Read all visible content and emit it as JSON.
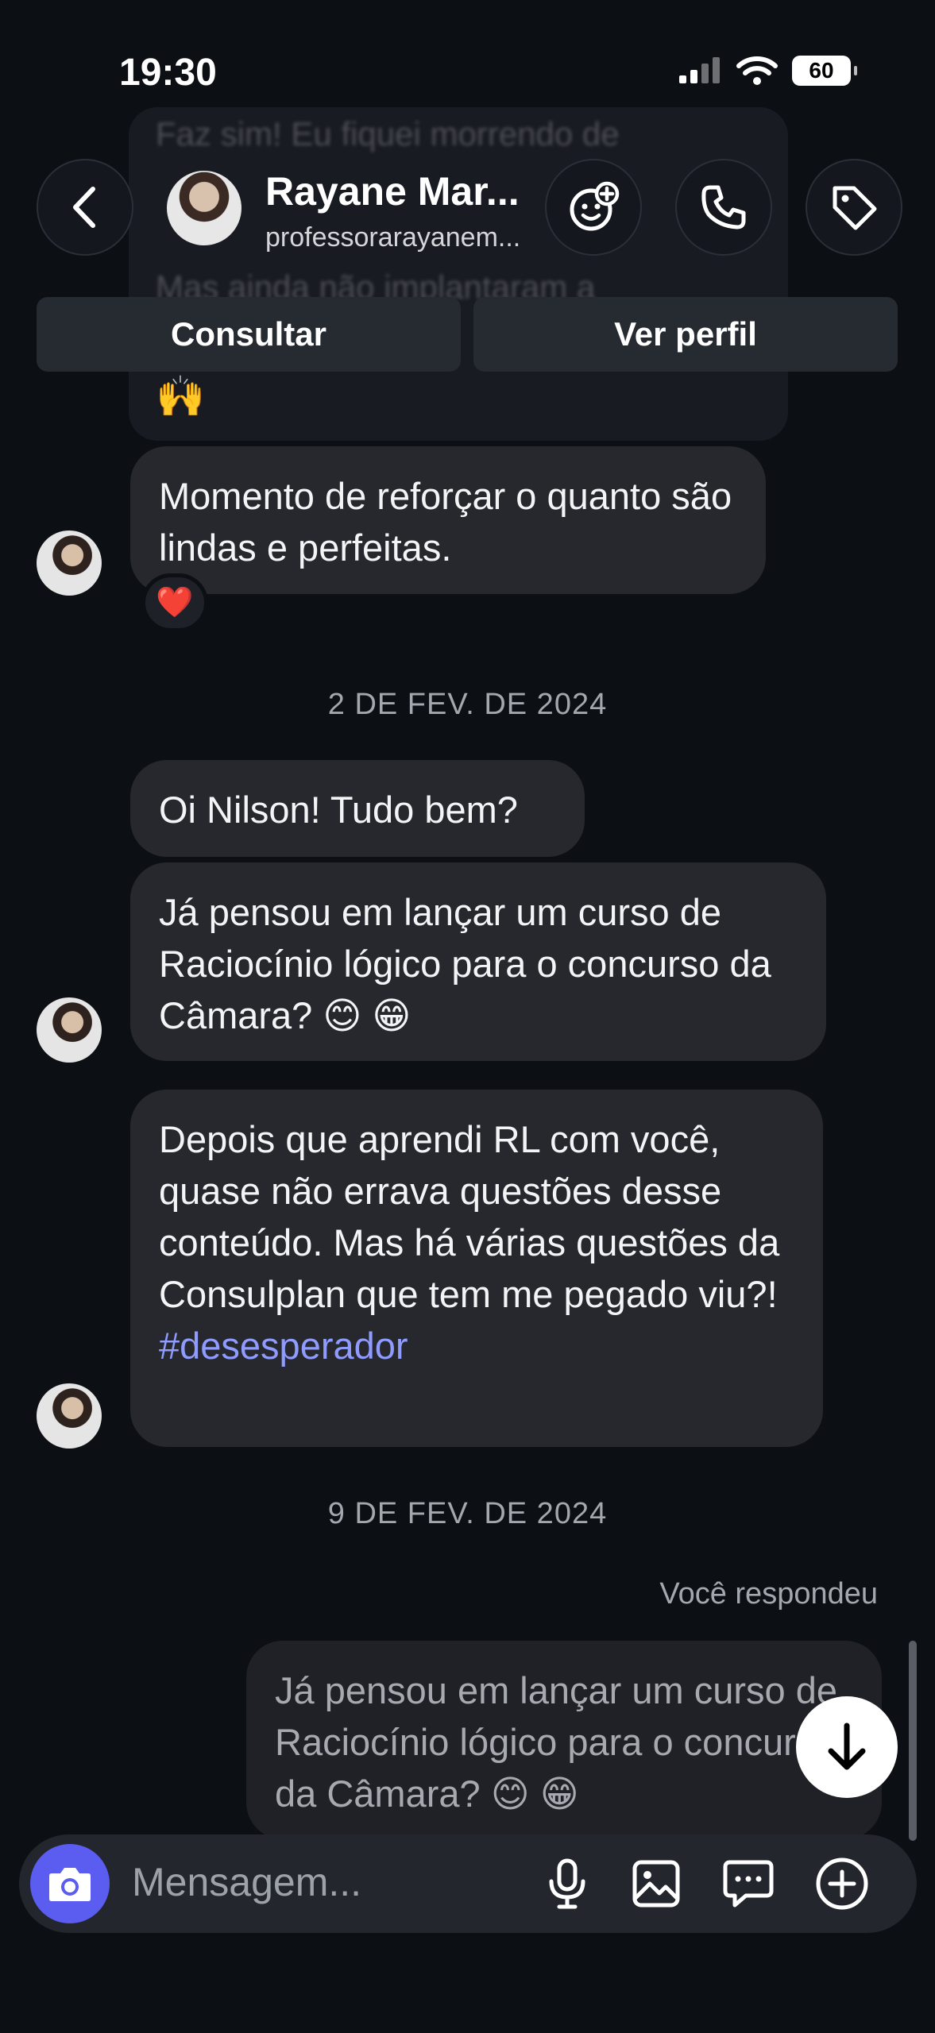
{
  "status_bar": {
    "time": "19:30",
    "battery": "60"
  },
  "header": {
    "name": "Rayane Mar...",
    "username": "professorarayanem...",
    "consult_label": "Consultar",
    "profile_label": "Ver perfil",
    "icons": {
      "back": "chevron-left-icon",
      "effects": "sticker-smiley-icon",
      "call": "phone-icon",
      "label": "tag-icon"
    }
  },
  "conversation": {
    "ghost_lines": [
      "Faz sim! Eu fiquei morrendo de",
      "Mas ainda não implantaram a",
      "🙌"
    ],
    "messages": [
      {
        "id": "m1",
        "text": "Momento de reforçar o quanto são lindas e perfeitas.",
        "reaction": "❤️"
      },
      {
        "id": "m2",
        "text": "Oi Nilson! Tudo bem?"
      },
      {
        "id": "m3",
        "text": "Já pensou em lançar um curso de Raciocínio lógico para o concurso da Câmara? 😊 😁"
      },
      {
        "id": "m4",
        "text": "Depois que aprendi RL com você, quase não errava questões desse conteúdo. Mas há várias questões da Consulplan que tem me pegado viu?!",
        "hashtag": "#desesperador"
      }
    ],
    "date_1": "2 DE FEV. DE 2024",
    "date_2": "9 DE FEV. DE 2024",
    "reply_label": "Você respondeu",
    "replied_quote": "Já pensou em lançar um curso de Raciocínio lógico para o concurso da Câmara? 😊 😁"
  },
  "composer": {
    "placeholder": "Mensagem...",
    "icons": [
      "camera-icon",
      "microphone-icon",
      "gallery-icon",
      "sticker-chat-icon",
      "plus-circle-icon"
    ]
  },
  "colors": {
    "background": "#0c0f14",
    "bubble": "#26282e",
    "hashtag": "#8f9bff",
    "camera_button": "#5b5cf0"
  }
}
